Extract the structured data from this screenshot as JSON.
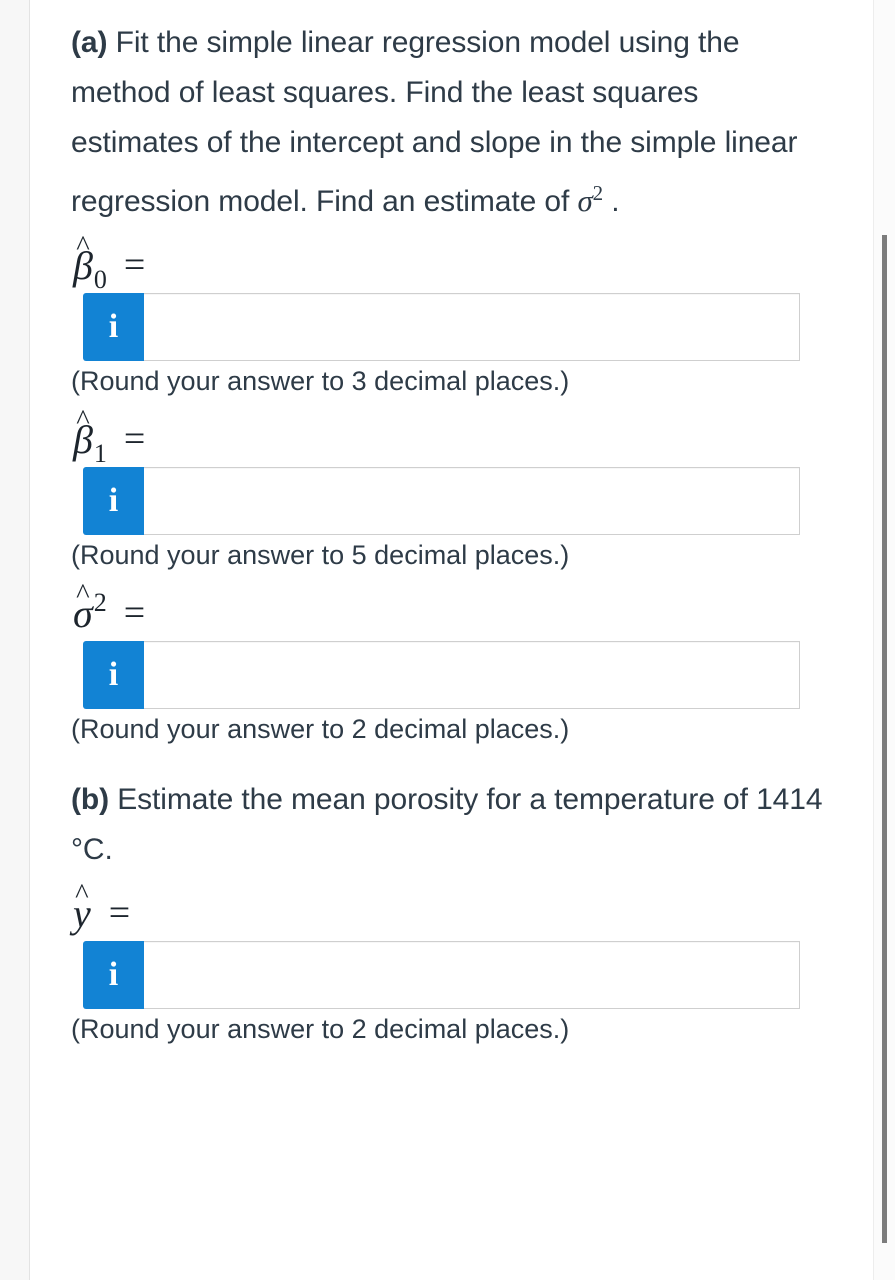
{
  "problem": {
    "part_a": {
      "label": "(a)",
      "text": " Fit the simple linear regression model using the method of least squares. Find the least squares estimates of the intercept and slope in the simple linear regression model. Find an estimate of ",
      "symbol_sigma": "σ",
      "symbol_sigma_exponent": "2",
      "text_end": " ."
    },
    "part_b": {
      "label": "(b)",
      "text": " Estimate the mean porosity for a temperature of 1414 °C."
    }
  },
  "fields": [
    {
      "id": "beta0",
      "symbol": "β",
      "subscript": "0",
      "superscript": "",
      "hat": "^",
      "equals": "=",
      "info_icon": "info-icon",
      "info_glyph": "i",
      "value": "",
      "placeholder": "",
      "rounding_note": "(Round your answer to 3 decimal places.)"
    },
    {
      "id": "beta1",
      "symbol": "β",
      "subscript": "1",
      "superscript": "",
      "hat": "^",
      "equals": "=",
      "info_icon": "info-icon",
      "info_glyph": "i",
      "value": "",
      "placeholder": "",
      "rounding_note": "(Round your answer to 5 decimal places.)"
    },
    {
      "id": "sigma2",
      "symbol": "σ",
      "subscript": "",
      "superscript": "2",
      "hat": "^",
      "equals": "=",
      "info_icon": "info-icon",
      "info_glyph": "i",
      "value": "",
      "placeholder": "",
      "rounding_note": "(Round your answer to 2 decimal places.)"
    },
    {
      "id": "yhat",
      "symbol": "y",
      "subscript": "",
      "superscript": "",
      "hat": "^",
      "equals": "=",
      "info_icon": "info-icon",
      "info_glyph": "i",
      "value": "",
      "placeholder": "",
      "rounding_note": "(Round your answer to 2 decimal places.)"
    }
  ],
  "colors": {
    "accent_blue": "#1283d4",
    "text": "#2e3b47",
    "math_text": "#1d252d",
    "input_border": "#cfcfcf",
    "scrollbar_thumb": "#7c7c7c",
    "gutter": "#f7f7f7"
  }
}
